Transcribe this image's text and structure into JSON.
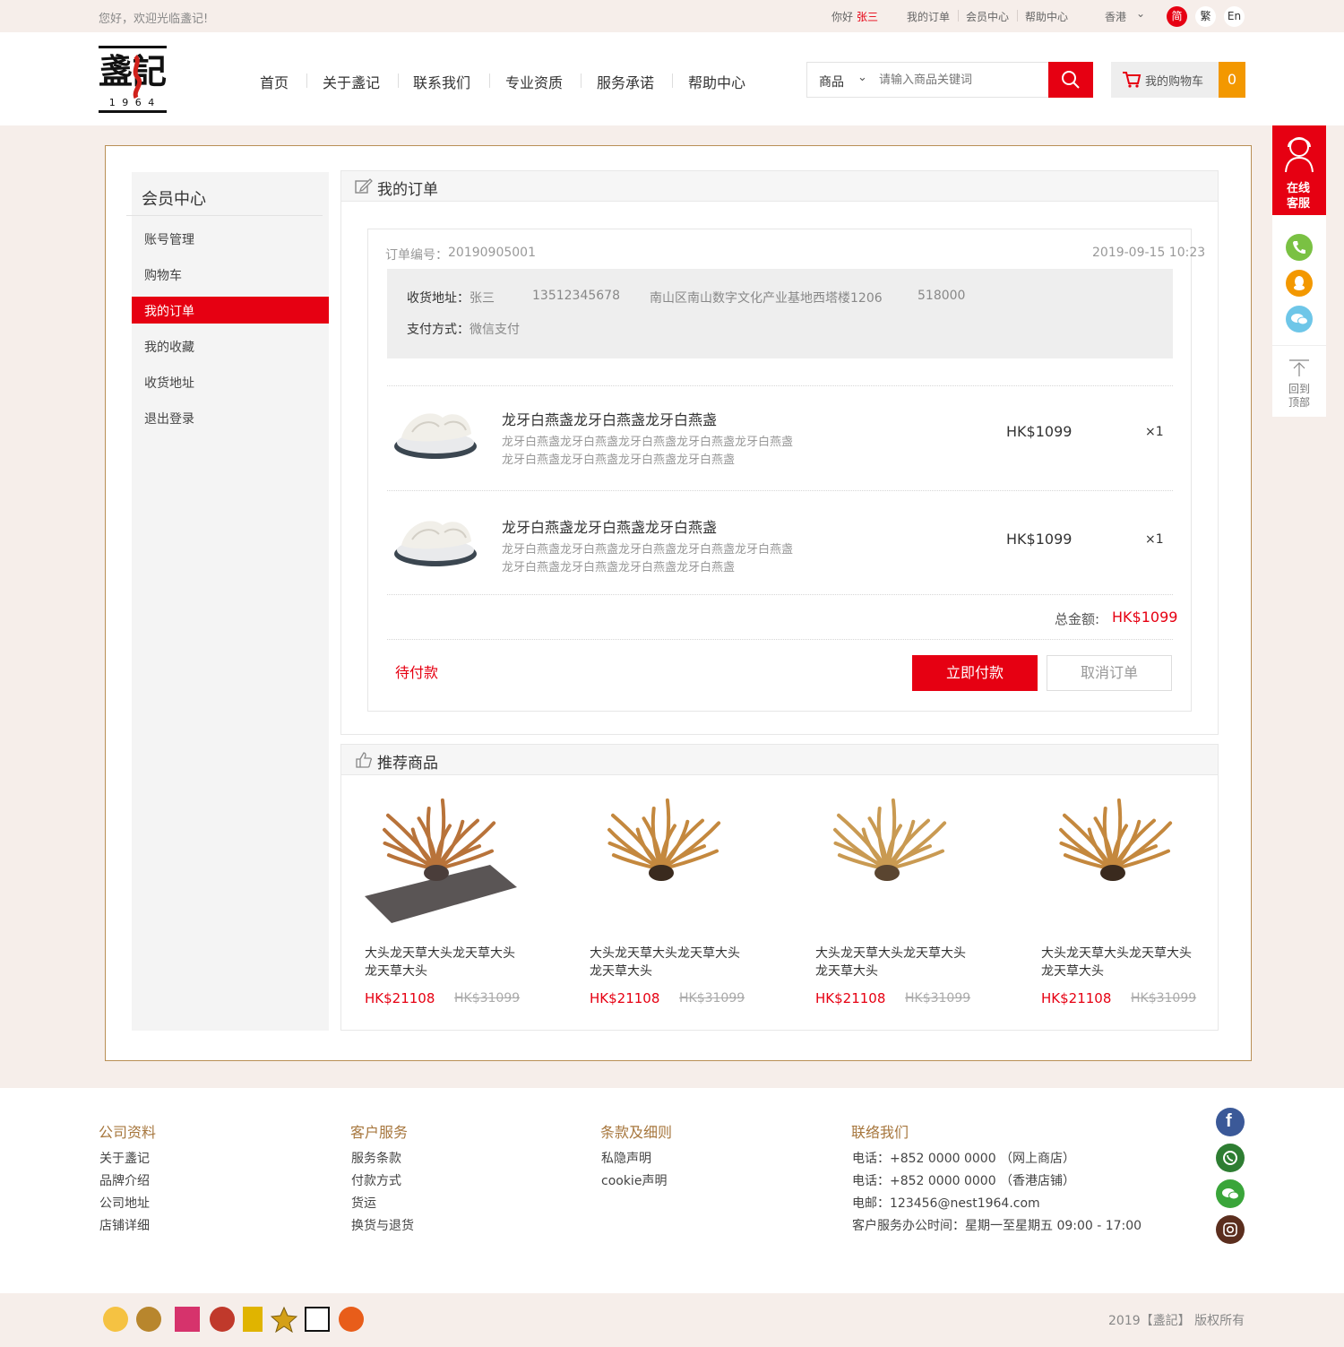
{
  "topbar": {
    "greeting": "您好，欢迎光临盞记!",
    "hello": "你好",
    "username": "张三",
    "links": [
      "我的订单",
      "会员中心",
      "帮助中心"
    ],
    "region": "香港",
    "langs": [
      "简",
      "繁",
      "En"
    ]
  },
  "header": {
    "logo_text": "盞記",
    "logo_year": "1 9 6 4",
    "nav": [
      "首页",
      "关于盞记",
      "联系我们",
      "专业资质",
      "服务承诺",
      "帮助中心"
    ],
    "search": {
      "category": "商品",
      "placeholder": "请输入商品关键词"
    },
    "cart_label": "我的购物车",
    "cart_count": "0"
  },
  "sidebar": {
    "title": "会员中心",
    "items": [
      "账号管理",
      "购物车",
      "我的订单",
      "我的收藏",
      "收货地址",
      "退出登录"
    ],
    "active": "我的订单"
  },
  "orders": {
    "title": "我的订单",
    "order_no_label": "订单编号：",
    "order_no": "20190905001",
    "datetime": "2019-09-15 10:23",
    "address_label": "收货地址：",
    "recipient": "张三",
    "phone": "13512345678",
    "address": "南山区南山数字文化产业基地西塔楼1206",
    "postcode": "518000",
    "payment_label": "支付方式：",
    "payment": "微信支付",
    "items": [
      {
        "name": "龙牙白燕盏龙牙白燕盏龙牙白燕盏",
        "desc1": "龙牙白燕盏龙牙白燕盏龙牙白燕盏龙牙白燕盏龙牙白燕盏",
        "desc2": "龙牙白燕盏龙牙白燕盏龙牙白燕盏龙牙白燕盏",
        "price": "HK$1099",
        "qty": "×1"
      },
      {
        "name": "龙牙白燕盏龙牙白燕盏龙牙白燕盏",
        "desc1": "龙牙白燕盏龙牙白燕盏龙牙白燕盏龙牙白燕盏龙牙白燕盏",
        "desc2": "龙牙白燕盏龙牙白燕盏龙牙白燕盏龙牙白燕盏",
        "price": "HK$1099",
        "qty": "×1"
      }
    ],
    "total_label": "总金额:",
    "total": "HK$1099",
    "status": "待付款",
    "pay_button": "立即付款",
    "cancel_button": "取消订单"
  },
  "recommend": {
    "title": "推荐商品",
    "items": [
      {
        "name1": "大头龙天草大头龙天草大头",
        "name2": "龙天草大头",
        "price": "HK$21108",
        "old_price": "HK$31099"
      },
      {
        "name1": "大头龙天草大头龙天草大头",
        "name2": "龙天草大头",
        "price": "HK$21108",
        "old_price": "HK$31099"
      },
      {
        "name1": "大头龙天草大头龙天草大头",
        "name2": "龙天草大头",
        "price": "HK$21108",
        "old_price": "HK$31099"
      },
      {
        "name1": "大头龙天草大头龙天草大头",
        "name2": "龙天草大头",
        "price": "HK$21108",
        "old_price": "HK$31099"
      }
    ]
  },
  "float": {
    "service_1": "在线",
    "service_2": "客服",
    "top_1": "回到",
    "top_2": "顶部"
  },
  "footer": {
    "cols": [
      {
        "title": "公司资料",
        "links": [
          "关于盞记",
          "品牌介绍",
          "公司地址",
          "店铺详细"
        ]
      },
      {
        "title": "客户服务",
        "links": [
          "服务条款",
          "付款方式",
          "货运",
          "换货与退货"
        ]
      },
      {
        "title": "条款及细则",
        "links": [
          "私隐声明",
          "cookie声明"
        ]
      },
      {
        "title": "联络我们",
        "links": [
          "电话：+852 0000 0000 （网上商店）",
          "电话：+852 0000 0000 （香港店铺）",
          "电邮：123456@nest1964.com",
          "客户服务办公时间：星期一至星期五 09:00 - 17:00"
        ]
      }
    ],
    "copyright": "2019【盞記】 版权所有"
  },
  "colors": {
    "accent": "#e60012",
    "brand_gold": "#a7773e",
    "cart_orange": "#f39800"
  }
}
